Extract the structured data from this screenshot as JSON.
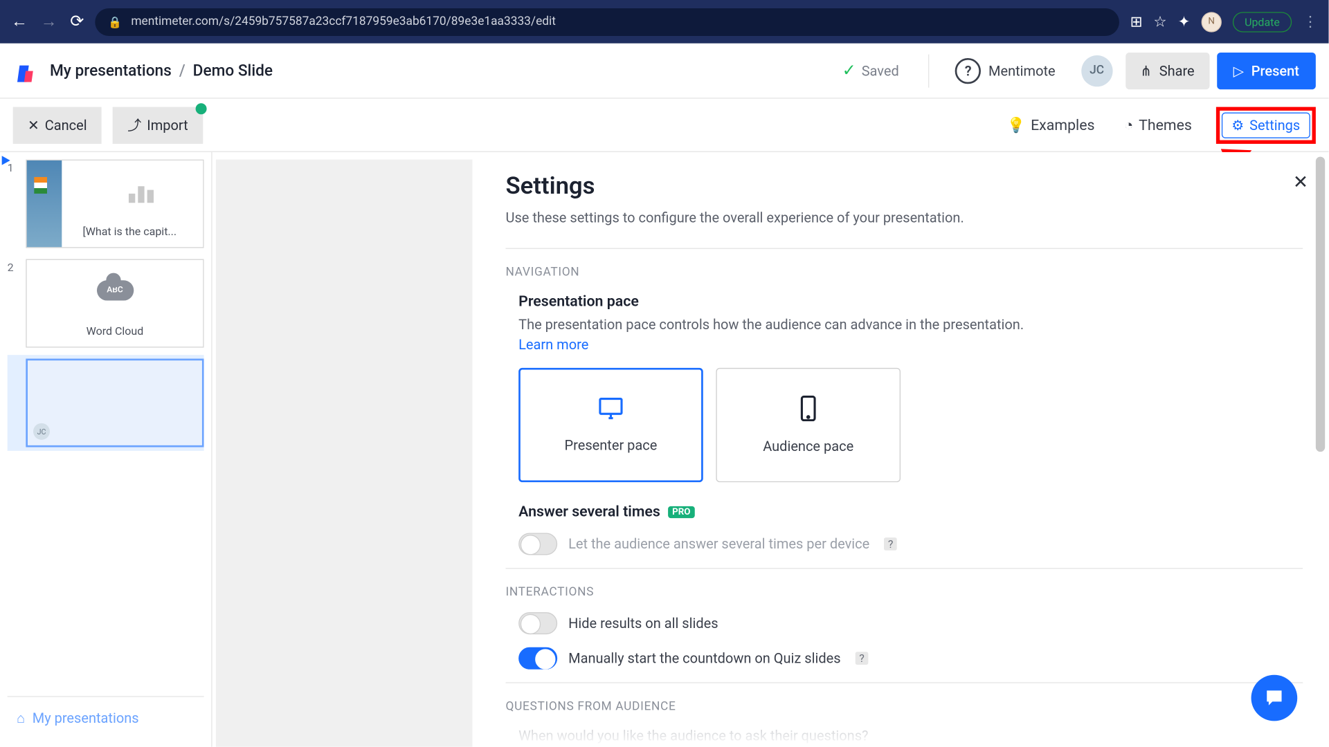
{
  "browser": {
    "url": "mentimeter.com/s/2459b757587a23ccf7187959e3ab6170/89e3e1aa3333/edit",
    "update_label": "Update"
  },
  "header": {
    "breadcrumb_root": "My presentations",
    "breadcrumb_sep": "/",
    "breadcrumb_current": "Demo Slide",
    "saved_label": "Saved",
    "mentimote_label": "Mentimote",
    "avatar_initials": "JC",
    "share_label": "Share",
    "present_label": "Present"
  },
  "toolbar": {
    "cancel_label": "Cancel",
    "import_label": "Import",
    "examples_label": "Examples",
    "themes_label": "Themes",
    "settings_label": "Settings"
  },
  "sidebar": {
    "slides": [
      {
        "num": "1",
        "caption": "[What is the capit..."
      },
      {
        "num": "2",
        "caption": "Word Cloud",
        "cloud_text": "ABC"
      },
      {
        "num": "",
        "caption": "",
        "mini_avatar": "JC"
      }
    ],
    "footer_label": "My presentations"
  },
  "settings": {
    "title": "Settings",
    "subtitle": "Use these settings to configure the overall experience of your presentation.",
    "nav_section": "NAVIGATION",
    "pace_title": "Presentation pace",
    "pace_desc": "The presentation pace controls how the audience can advance in the presentation.",
    "learn_more": "Learn more",
    "presenter_pace": "Presenter pace",
    "audience_pace": "Audience pace",
    "answer_title": "Answer several times",
    "pro_badge": "PRO",
    "answer_toggle_label": "Let the audience answer several times per device",
    "q_badge": "?",
    "interactions_section": "INTERACTIONS",
    "hide_results_label": "Hide results on all slides",
    "manual_countdown_label": "Manually start the countdown on Quiz slides",
    "questions_section": "QUESTIONS FROM AUDIENCE",
    "questions_desc": "When would you like the audience to ask their questions?"
  }
}
